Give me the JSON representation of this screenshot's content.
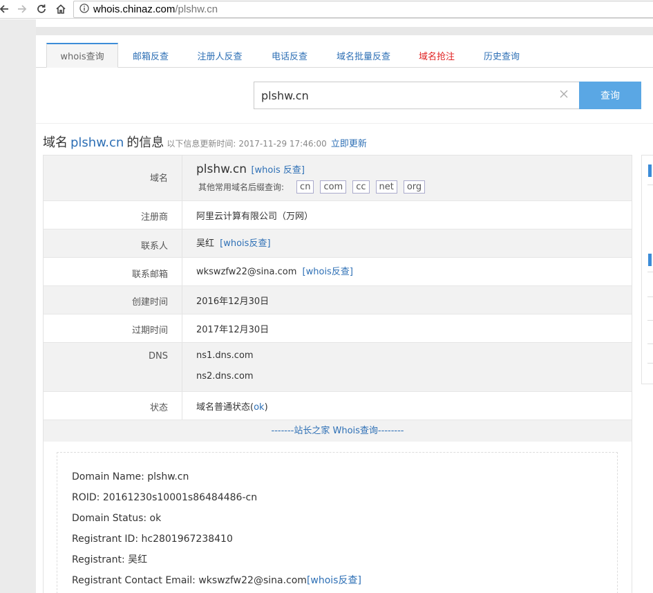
{
  "browser": {
    "url_host": "whois.chinaz.com",
    "url_path": "/plshw.cn"
  },
  "tabs": [
    {
      "label": "whois查询"
    },
    {
      "label": "邮箱反查"
    },
    {
      "label": "注册人反查"
    },
    {
      "label": "电话反查"
    },
    {
      "label": "域名批量反查"
    },
    {
      "label": "域名抢注"
    },
    {
      "label": "历史查询"
    }
  ],
  "search": {
    "value": "plshw.cn",
    "button_label": "查询"
  },
  "heading": {
    "prefix": "域名",
    "domain": "plshw.cn",
    "suffix": "的信息",
    "update_label": "以下信息更新时间:",
    "update_time": "2017-11-29 17:46:00",
    "refresh_link": "立即更新"
  },
  "table": {
    "domain_row": {
      "label": "域名",
      "domain": "plshw.cn",
      "whois_link": "[whois 反查]",
      "suffix_label": "其他常用域名后缀查询:",
      "suffixes": [
        "cn",
        "com",
        "cc",
        "net",
        "org"
      ]
    },
    "registrar": {
      "label": "注册商",
      "value": "阿里云计算有限公司（万网）"
    },
    "contact": {
      "label": "联系人",
      "value": "吴红",
      "link": "[whois反查]"
    },
    "email": {
      "label": "联系邮箱",
      "value": "wkswzfw22@sina.com",
      "link": "[whois反查]"
    },
    "created": {
      "label": "创建时间",
      "value": "2016年12月30日"
    },
    "expires": {
      "label": "过期时间",
      "value": "2017年12月30日"
    },
    "dns": {
      "label": "DNS",
      "values": [
        "ns1.dns.com",
        "ns2.dns.com"
      ]
    },
    "status": {
      "label": "状态",
      "value_pre": "域名普通状态(",
      "value_link": "ok",
      "value_post": ")"
    },
    "section_title": "-------站长之家 Whois查询--------"
  },
  "raw_whois": {
    "lines": [
      "Domain Name: plshw.cn",
      "ROID: 20161230s10001s86484486-cn",
      "Domain Status: ok",
      "Registrant ID: hc2801967238410",
      "Registrant: 吴红"
    ],
    "email_line_text": "Registrant Contact Email: wkswzfw22@sina.com",
    "email_line_link": "[whois反查]"
  },
  "icons": {
    "back": "back-arrow-icon",
    "forward": "forward-arrow-icon",
    "reload": "reload-icon",
    "home": "home-icon",
    "info": "info-circle-icon",
    "clear": "clear-x-icon"
  },
  "colors": {
    "link": "#2d6fb5",
    "button": "#5aa7e4",
    "accent_red": "#e02020"
  }
}
